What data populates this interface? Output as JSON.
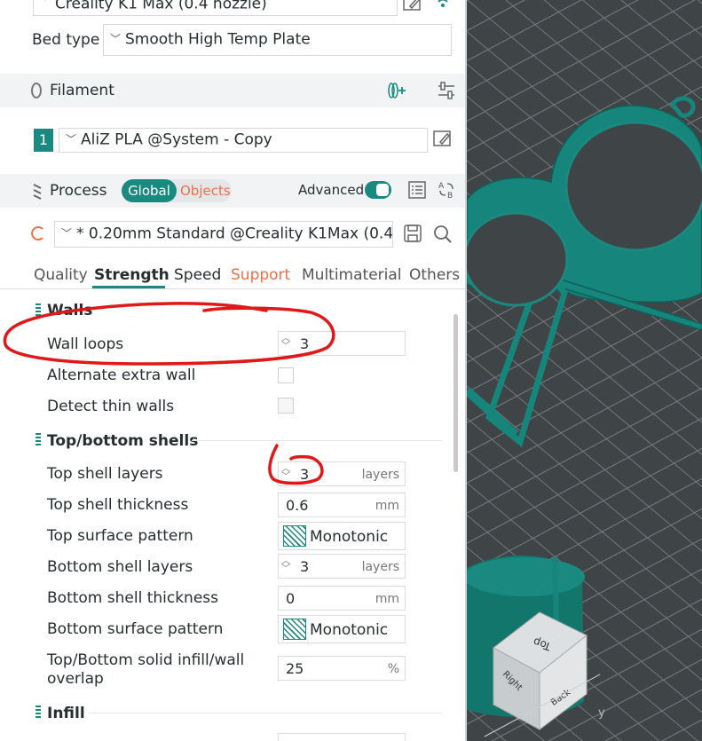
{
  "printer": {
    "value": "Creality K1 Max (0.4 nozzle)"
  },
  "bed": {
    "label": "Bed type",
    "value": "Smooth High Temp Plate"
  },
  "filament": {
    "title": "Filament",
    "slot": "1",
    "value": "AliZ PLA @System - Copy"
  },
  "process": {
    "title": "Process",
    "toggle_global": "Global",
    "toggle_objects": "Objects",
    "advanced_label": "Advanced",
    "preset": "* 0.20mm Standard @Creality K1Max (0.4..."
  },
  "tabs": [
    {
      "label": "Quality"
    },
    {
      "label": "Strength"
    },
    {
      "label": "Speed"
    },
    {
      "label": "Support"
    },
    {
      "label": "Multimaterial"
    },
    {
      "label": "Others"
    }
  ],
  "walls": {
    "title": "Walls",
    "wall_loops": {
      "label": "Wall loops",
      "value": "3"
    },
    "alternate_extra_wall": {
      "label": "Alternate extra wall"
    },
    "detect_thin_walls": {
      "label": "Detect thin walls"
    }
  },
  "shells": {
    "title": "Top/bottom shells",
    "top_shell_layers": {
      "label": "Top shell layers",
      "value": "3",
      "unit": "layers"
    },
    "top_shell_thickness": {
      "label": "Top shell thickness",
      "value": "0.6",
      "unit": "mm"
    },
    "top_surface_pattern": {
      "label": "Top surface pattern",
      "value": "Monotonic ..."
    },
    "bottom_shell_layers": {
      "label": "Bottom shell layers",
      "value": "3",
      "unit": "layers"
    },
    "bottom_shell_thickness": {
      "label": "Bottom shell thickness",
      "value": "0",
      "unit": "mm"
    },
    "bottom_surface_pattern": {
      "label": "Bottom surface pattern",
      "value": "Monotonic"
    },
    "overlap": {
      "label_line1": "Top/Bottom solid infill/wall",
      "label_line2": "overlap",
      "value": "25",
      "unit": "%"
    }
  },
  "infill": {
    "title": "Infill"
  },
  "view_cube": {
    "top": "Top",
    "right": "Right",
    "back": "Back",
    "axis_y": "y"
  },
  "colors": {
    "accent": "#1a8a80",
    "model": "#16857b",
    "annotation": "#e01818",
    "orange": "#e8704a"
  }
}
